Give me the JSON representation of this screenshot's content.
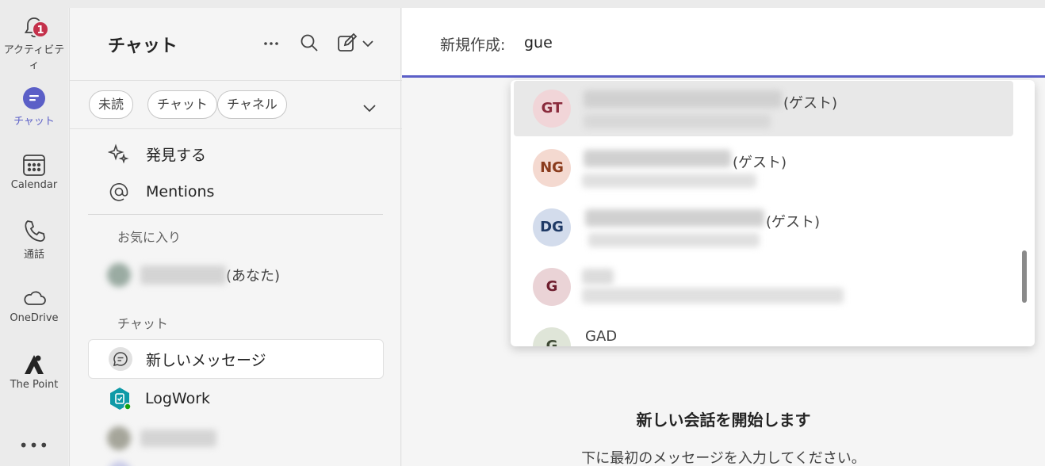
{
  "rail": {
    "activity": {
      "label": "アクティビティ",
      "badge": "1"
    },
    "chat": {
      "label": "チャット"
    },
    "calendar": {
      "label": "Calendar"
    },
    "calls": {
      "label": "通話"
    },
    "onedrive": {
      "label": "OneDrive"
    },
    "thepoint": {
      "label": "The Point"
    },
    "more": "•••"
  },
  "left": {
    "title": "チャット",
    "filters": [
      "未読",
      "チャット",
      "チャネル"
    ],
    "nav": [
      {
        "label": "発見する",
        "icon": "sparkle-icon"
      },
      {
        "label": "Mentions",
        "icon": "at-icon"
      }
    ],
    "favorites_label": "お気に入り",
    "favorite_suffix": "(あなた)",
    "chats_label": "チャット",
    "chats": [
      {
        "label": "新しいメッセージ",
        "icon": "chat-bubble-icon"
      },
      {
        "label": "LogWork",
        "icon": "logwork-app-icon"
      }
    ]
  },
  "compose": {
    "to_label": "新規作成:",
    "to_value": "gue",
    "suggestions": [
      {
        "initials": "GT",
        "guest": "(ゲスト)",
        "bg": "#f1d5d8",
        "fg": "#8a2b3c"
      },
      {
        "initials": "NG",
        "guest": "(ゲスト)",
        "bg": "#f4d9d0",
        "fg": "#8a3b1c"
      },
      {
        "initials": "DG",
        "guest": "(ゲスト)",
        "bg": "#d3dcec",
        "fg": "#1f3a66"
      },
      {
        "initials": "G",
        "guest": "",
        "bg": "#ead3d6",
        "fg": "#6e1e2e"
      },
      {
        "initials": "G",
        "name": "GAD",
        "bg": "#dfe5d8",
        "fg": "#3f4a35"
      }
    ],
    "empty_title": "新しい会話を開始します",
    "empty_subtitle": "下に最初のメッセージを入力してください。"
  },
  "colors": {
    "accent": "#5b5fc7",
    "badge": "#c4314b"
  }
}
